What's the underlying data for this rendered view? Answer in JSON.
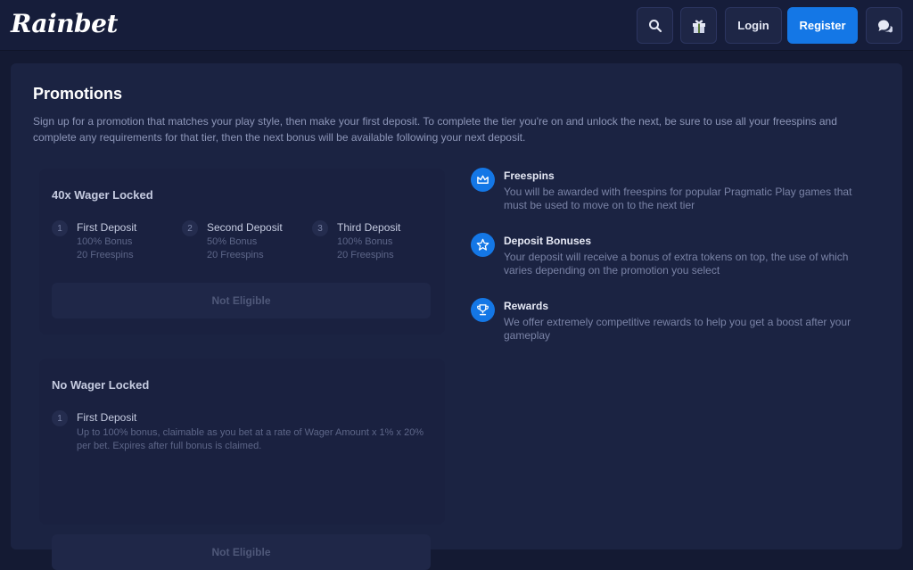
{
  "header": {
    "logo": "Rainbet",
    "login_label": "Login",
    "register_label": "Register",
    "icons": [
      "search-icon",
      "gift-icon",
      "chat-icon"
    ]
  },
  "promotions": {
    "title": "Promotions",
    "description": "Sign up for a promotion that matches your play style, then make your first deposit. To complete the tier you're on and unlock the next, be sure to use all your freespins and complete any requirements for that tier, then the next bonus will be available following your next deposit.",
    "cards": [
      {
        "title": "40x Wager Locked",
        "tiers": [
          {
            "num": "1",
            "name": "First Deposit",
            "line1": "100% Bonus",
            "line2": "20 Freespins"
          },
          {
            "num": "2",
            "name": "Second Deposit",
            "line1": "50% Bonus",
            "line2": "20 Freespins"
          },
          {
            "num": "3",
            "name": "Third Deposit",
            "line1": "100% Bonus",
            "line2": "20 Freespins"
          }
        ],
        "status": "Not Eligible"
      },
      {
        "title": "No Wager Locked",
        "tiers": [
          {
            "num": "1",
            "name": "First Deposit",
            "line1": "Up to 100% bonus, claimable as you bet at a rate of Wager Amount x 1% x 20% per bet. Expires after full bonus is claimed."
          }
        ],
        "status": "Not Eligible"
      }
    ],
    "features": [
      {
        "icon": "crown-icon",
        "title": "Freespins",
        "desc": "You will be awarded with freespins for popular Pragmatic Play games that must be used to move on to the next tier"
      },
      {
        "icon": "star-icon",
        "title": "Deposit Bonuses",
        "desc": "Your deposit will receive a bonus of extra tokens on top, the use of which varies depending on the promotion you select"
      },
      {
        "icon": "trophy-icon",
        "title": "Rewards",
        "desc": "We offer extremely competitive rewards to help you get a boost after your gameplay"
      }
    ]
  },
  "colors": {
    "accent": "#1477e6",
    "background": "#141a33",
    "panel": "#1b2342"
  }
}
